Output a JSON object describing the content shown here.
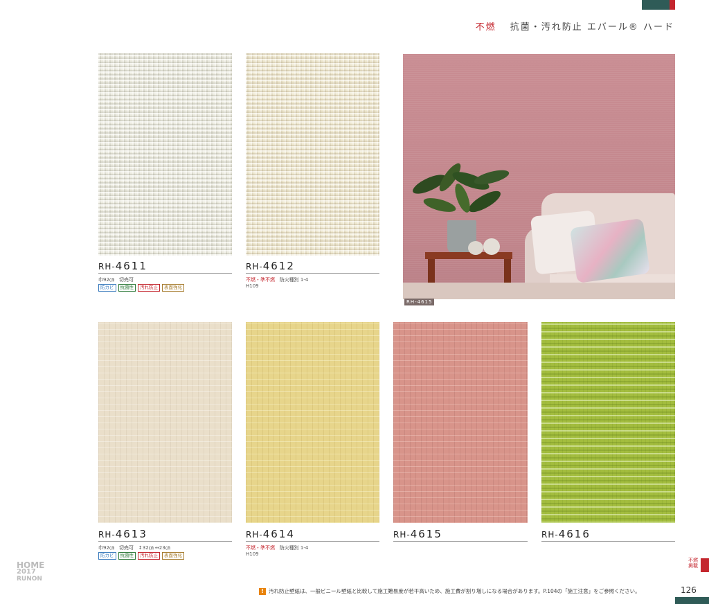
{
  "header": {
    "fire_tag": "不燃",
    "title": "抗菌・汚れ防止 エバール® ハード"
  },
  "products": [
    {
      "prefix": "RH-",
      "number": "4611",
      "spec": "巾92㎝　切売可",
      "fire": "",
      "fire_note": "",
      "code_note": "",
      "badges": [
        "防カビ",
        "抗菌性",
        "汚れ防止",
        "表面強化"
      ],
      "color": "#ecebe0"
    },
    {
      "prefix": "RH-",
      "number": "4612",
      "spec": "",
      "fire": "不燃・準不燃",
      "fire_note": "防火種別 1-4",
      "code_note": "H109",
      "badges": [],
      "color": "#efe9d2"
    },
    {
      "prefix": "RH-",
      "number": "4613",
      "spec": "巾92㎝　切売可　↕32㎝ ↔23㎝",
      "fire": "",
      "fire_note": "",
      "code_note": "",
      "badges": [
        "防カビ",
        "抗菌性",
        "汚れ防止",
        "表面強化"
      ],
      "color": "#eadfca"
    },
    {
      "prefix": "RH-",
      "number": "4614",
      "spec": "",
      "fire": "不燃・準不燃",
      "fire_note": "防火種別 1-4",
      "code_note": "H109",
      "badges": [],
      "color": "#e7d58b"
    },
    {
      "prefix": "RH-",
      "number": "4615",
      "spec": "",
      "fire": "",
      "fire_note": "",
      "code_note": "",
      "badges": [],
      "color": "#d8948a"
    },
    {
      "prefix": "RH-",
      "number": "4616",
      "spec": "",
      "fire": "",
      "fire_note": "",
      "code_note": "",
      "badges": [],
      "color": "#a3bd3e"
    }
  ],
  "room_photo": {
    "label": "RH-4615"
  },
  "brand": {
    "line1": "HOME",
    "line2": "2017",
    "line3": "RUNON"
  },
  "side_tab": {
    "line1": "不燃",
    "line2": "掲載"
  },
  "footer": {
    "warning_icon": "!",
    "note": "汚れ防止壁紙は、一般ビニール壁紙と比較して施工難易度が若干高いため、施工費が割り増しになる場合があります。P.104の「施工注意」をご参照ください。",
    "page_number": "126"
  },
  "colors": {
    "accent_red": "#c4262e",
    "accent_green": "#2f5b57",
    "badge_blue": "#3a7bbd",
    "badge_green": "#2f7a3a",
    "badge_tan": "#a67c2e"
  }
}
